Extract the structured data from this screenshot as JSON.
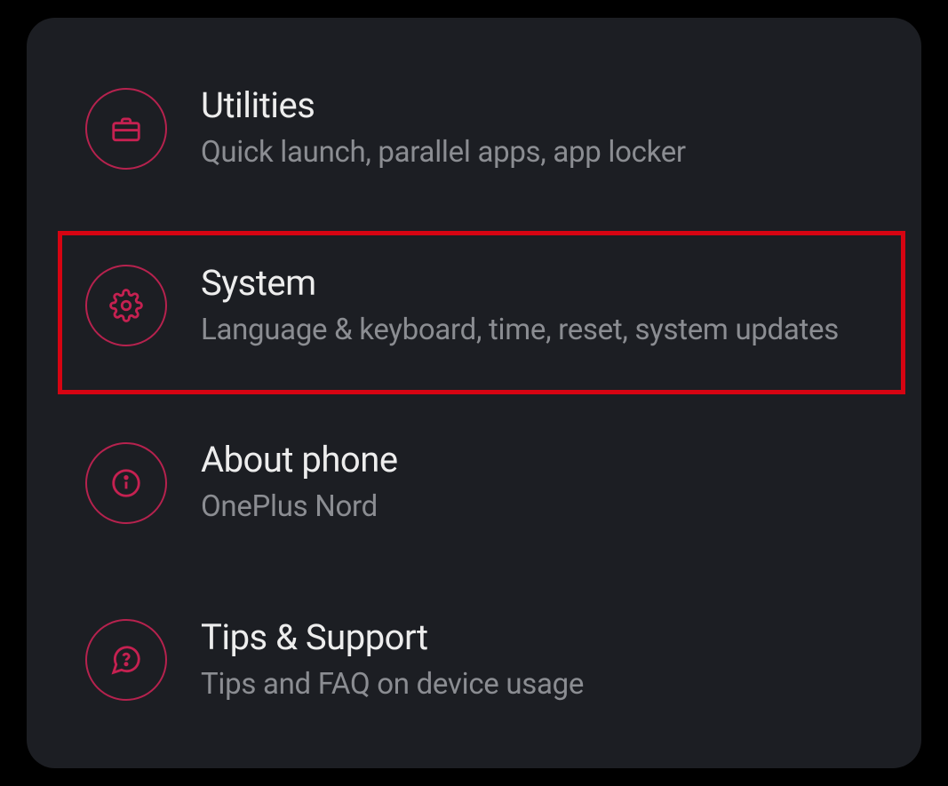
{
  "accent": "#c52151",
  "items": [
    {
      "id": "utilities",
      "icon": "briefcase-icon",
      "title": "Utilities",
      "subtitle": "Quick launch, parallel apps, app locker",
      "highlighted": false
    },
    {
      "id": "system",
      "icon": "gear-icon",
      "title": "System",
      "subtitle": "Language & keyboard, time, reset, system updates",
      "highlighted": true
    },
    {
      "id": "about-phone",
      "icon": "info-icon",
      "title": "About phone",
      "subtitle": "OnePlus Nord",
      "highlighted": false
    },
    {
      "id": "tips-support",
      "icon": "question-icon",
      "title": "Tips & Support",
      "subtitle": "Tips and FAQ on device usage",
      "highlighted": false
    }
  ]
}
